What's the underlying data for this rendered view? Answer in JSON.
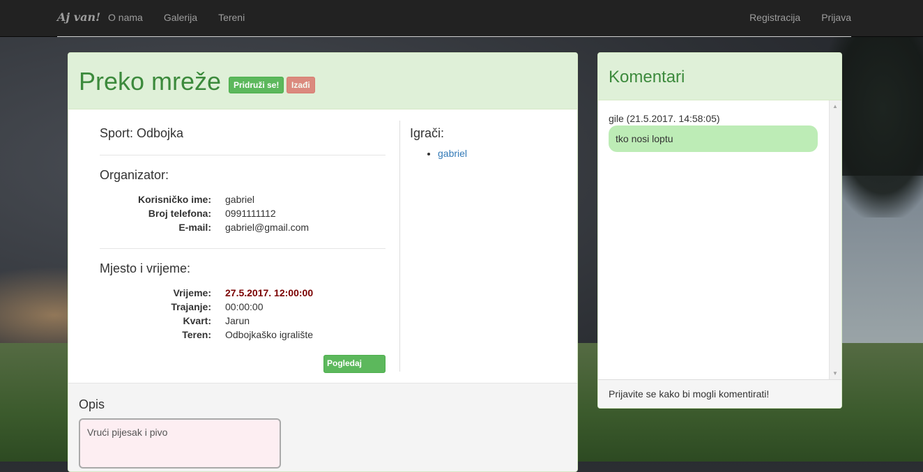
{
  "navbar": {
    "brand": "Aj van!",
    "left_links": [
      "O nama",
      "Galerija",
      "Tereni"
    ],
    "right_links": [
      "Registracija",
      "Prijava"
    ]
  },
  "event": {
    "title": "Preko mreže",
    "join_label": "Pridruži se!",
    "leave_label": "Izađi",
    "sport": "Sport: Odbojka",
    "organizer_heading": "Organizator:",
    "organizer": [
      {
        "label": "Korisničko ime:",
        "value": "gabriel"
      },
      {
        "label": "Broj telefona:",
        "value": "0991111112"
      },
      {
        "label": "E-mail:",
        "value": "gabriel@gmail.com"
      }
    ],
    "place_heading": "Mjesto i vrijeme:",
    "place": [
      {
        "label": "Vrijeme:",
        "value": "27.5.2017. 12:00:00"
      },
      {
        "label": "Trajanje:",
        "value": "00:00:00"
      },
      {
        "label": "Kvart:",
        "value": "Jarun"
      },
      {
        "label": "Teren:",
        "value": "Odbojkaško igralište"
      }
    ],
    "court_button": "Pogledaj detalje terena",
    "players_heading": "Igrači:",
    "players": [
      "gabriel"
    ],
    "description_heading": "Opis",
    "description": "Vrući pijesak i pivo"
  },
  "comments": {
    "title": "Komentari",
    "items": [
      {
        "meta": "gile (21.5.2017. 14:58:05)",
        "text": "tko nosi loptu"
      }
    ],
    "footer": "Prijavite se kako bi mogli komentirati!"
  },
  "colors": {
    "navbar": "#222222",
    "panel_heading": "#dff0d8",
    "accent_green": "#5cb85c",
    "danger": "#d9534f",
    "time_color": "#7a0000",
    "comment_bubble": "#bdecb6",
    "description_bg": "#fdeef2"
  }
}
